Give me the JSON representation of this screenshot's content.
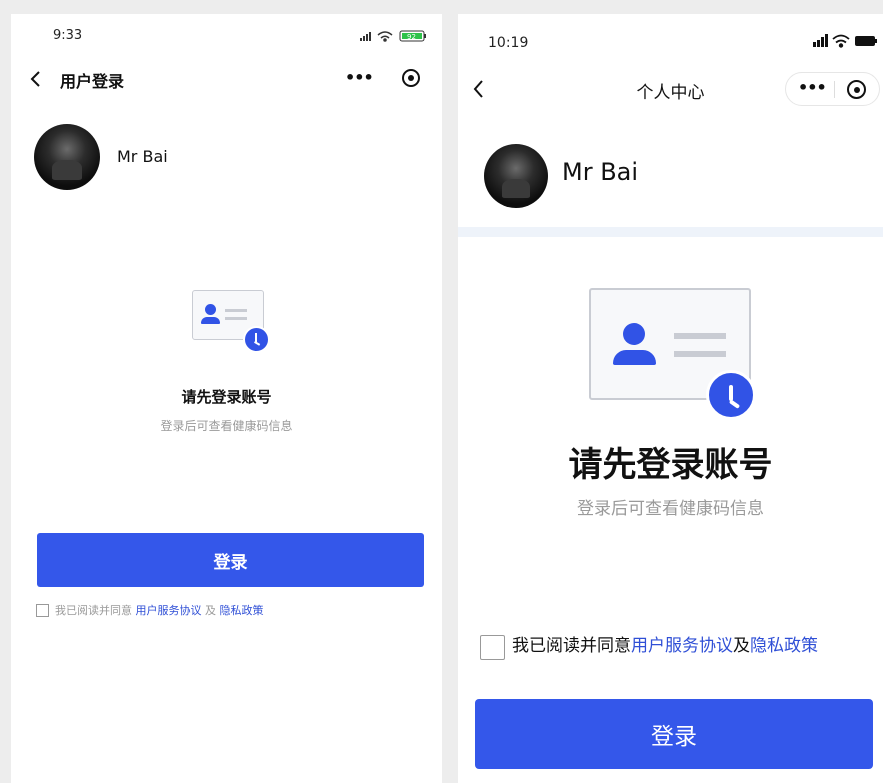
{
  "colors": {
    "accent": "#3457ea",
    "link": "#2f4fd6",
    "page_bg": "#ededed"
  },
  "screen_left": {
    "status_time": "9:33",
    "battery_label": "92",
    "nav_title": "用户登录",
    "user_name": "Mr Bai",
    "prompt_title": "请先登录账号",
    "prompt_subtitle": "登录后可查看健康码信息",
    "login_button": "登录",
    "agreement_prefix": "我已阅读并同意",
    "agreement_link1": "用户服务协议",
    "agreement_mid": "及",
    "agreement_link2": "隐私政策"
  },
  "screen_right": {
    "status_time": "10:19",
    "nav_title": "个人中心",
    "user_name": "Mr Bai",
    "prompt_title": "请先登录账号",
    "prompt_subtitle": "登录后可查看健康码信息",
    "login_button": "登录",
    "agreement_prefix": "我已阅读并同意",
    "agreement_link1": "用户服务协议",
    "agreement_mid": "及",
    "agreement_link2": "隐私政策"
  },
  "icons": [
    "back-chevron-icon",
    "more-dots-icon",
    "target-icon",
    "signal-icon",
    "wifi-icon",
    "battery-icon",
    "id-card-icon",
    "clock-icon"
  ]
}
